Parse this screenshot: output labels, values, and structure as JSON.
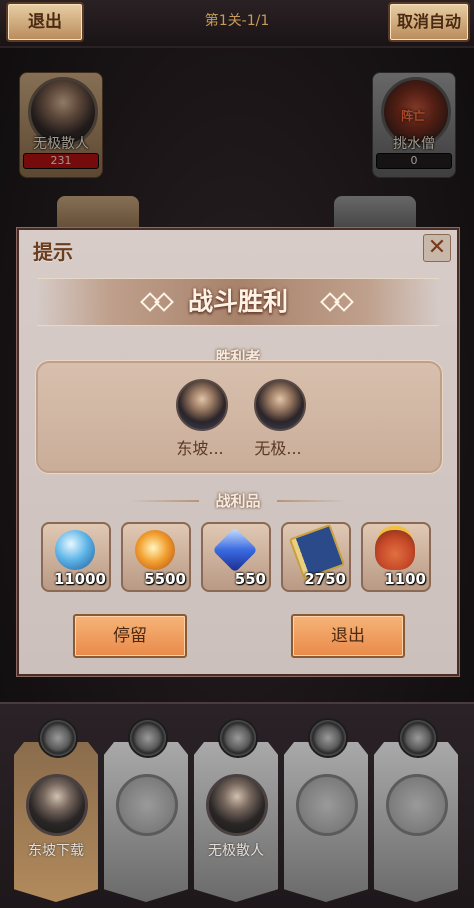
{
  "header": {
    "exit_label": "退出",
    "stage": "第1关-1/1",
    "cancel_auto_label": "取消自动"
  },
  "battlefield": {
    "ally": {
      "name": "无极散人",
      "hp": "231",
      "hp_fraction": 1.0
    },
    "enemy": {
      "name": "挑水僧",
      "hp": "0",
      "hp_fraction": 0.0,
      "status": "阵亡"
    }
  },
  "dialog": {
    "title": "提示",
    "close_icon": "close-icon",
    "banner": "战斗胜利",
    "winners_label": "胜利者",
    "winners": [
      {
        "name": "东坡..."
      },
      {
        "name": "无极..."
      }
    ],
    "loot_label": "战利品",
    "loot": [
      {
        "icon": "blue-crystal-orb-icon",
        "count": "11000",
        "color": "#5fb6e8"
      },
      {
        "icon": "fire-orb-icon",
        "count": "5500",
        "color": "#f2a030"
      },
      {
        "icon": "blue-gem-icon",
        "count": "550",
        "color": "#3a6ae0"
      },
      {
        "icon": "skill-book-icon",
        "count": "2750",
        "color": "#2a4a8a"
      },
      {
        "icon": "coin-bag-icon",
        "count": "1100",
        "color": "#c84a2a"
      }
    ],
    "stay_label": "停留",
    "exit_label": "退出"
  },
  "formation": {
    "slots": [
      {
        "name": "东坡下载",
        "filled": true
      },
      {
        "name": "",
        "filled": false
      },
      {
        "name": "无极散人",
        "filled": true
      },
      {
        "name": "",
        "filled": false
      },
      {
        "name": "",
        "filled": false
      }
    ]
  },
  "colors": {
    "accent_orange": "#e98a4a",
    "hp_red": "#b00d0d",
    "title_brown": "#6b3e1f"
  }
}
